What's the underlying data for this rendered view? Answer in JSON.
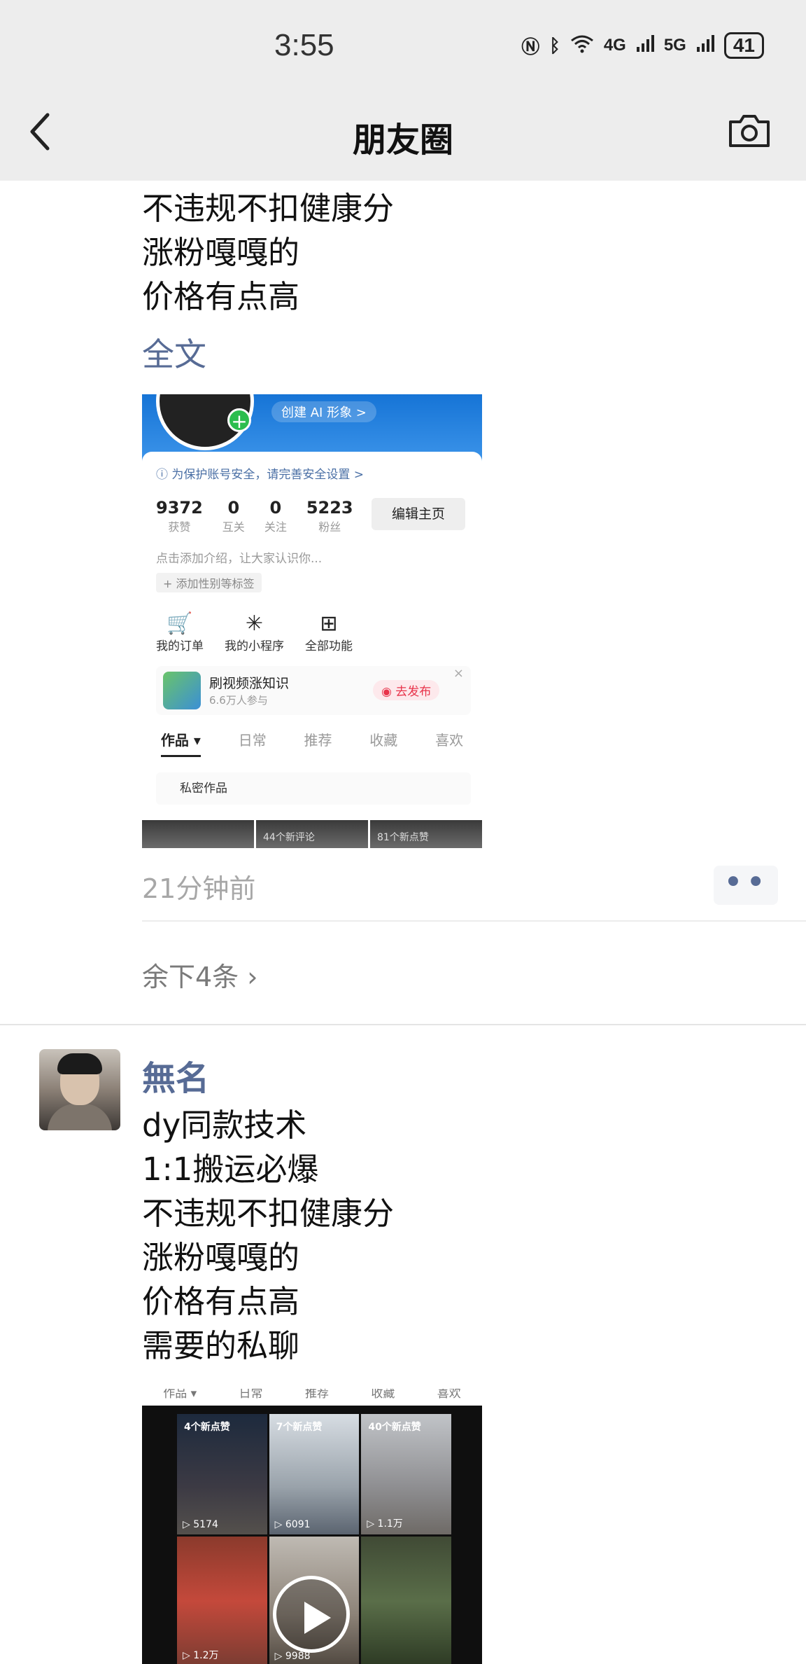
{
  "status": {
    "time": "3:55",
    "net1": "4G",
    "net2": "5G",
    "battery": "41"
  },
  "header": {
    "title": "朋友圈"
  },
  "post1": {
    "text_lines": [
      "不违规不扣健康分",
      "涨粉嘎嘎的",
      "价格有点高"
    ],
    "fulltext": "全文",
    "screenshot": {
      "ai_button": "创建 AI 形象 >",
      "safety_tip": "ⓘ 为保护账号安全，请完善安全设置 >",
      "stats": [
        {
          "num": "9372",
          "label": "获赞"
        },
        {
          "num": "0",
          "label": "互关"
        },
        {
          "num": "0",
          "label": "关注"
        },
        {
          "num": "5223",
          "label": "粉丝"
        }
      ],
      "edit_button": "编辑主页",
      "intro": "点击添加介绍，让大家认识你...",
      "tag": "+ 添加性别等标签",
      "functions": [
        {
          "icon": "cart-icon",
          "glyph": "🛒",
          "label": "我的订单"
        },
        {
          "icon": "asterisk-icon",
          "glyph": "✳",
          "label": "我的小程序"
        },
        {
          "icon": "grid-icon",
          "glyph": "⊞",
          "label": "全部功能"
        }
      ],
      "promo_title": "刷视频涨知识",
      "promo_sub": "6.6万人参与",
      "promo_button": "◉ 去发布",
      "tabs": [
        "作品 ▾",
        "日常",
        "推荐",
        "收藏",
        "喜欢"
      ],
      "private": "私密作品",
      "thumb_labels": [
        "",
        "44个新评论",
        "81个新点赞"
      ]
    },
    "time": "21分钟前",
    "remaining": "余下4条 ›"
  },
  "post2": {
    "username": "無名",
    "text_lines": [
      "dy同款技术",
      "1:1搬运必爆",
      "不违规不扣健康分",
      "涨粉嘎嘎的",
      "价格有点高",
      "需要的私聊"
    ],
    "screenshot": {
      "tabs": [
        "作品 ▾",
        "日常",
        "推荐",
        "收藏",
        "喜欢"
      ],
      "cells": [
        {
          "badge": "4个新点赞",
          "count": "▷ 5174"
        },
        {
          "badge": "7个新点赞",
          "count": "▷ 6091"
        },
        {
          "badge": "40个新点赞",
          "count": "▷ 1.1万"
        },
        {
          "badge": "",
          "count": "▷ 1.2万"
        },
        {
          "badge": "",
          "count": "▷ 9988"
        },
        {
          "badge": "",
          "count": ""
        }
      ]
    }
  }
}
